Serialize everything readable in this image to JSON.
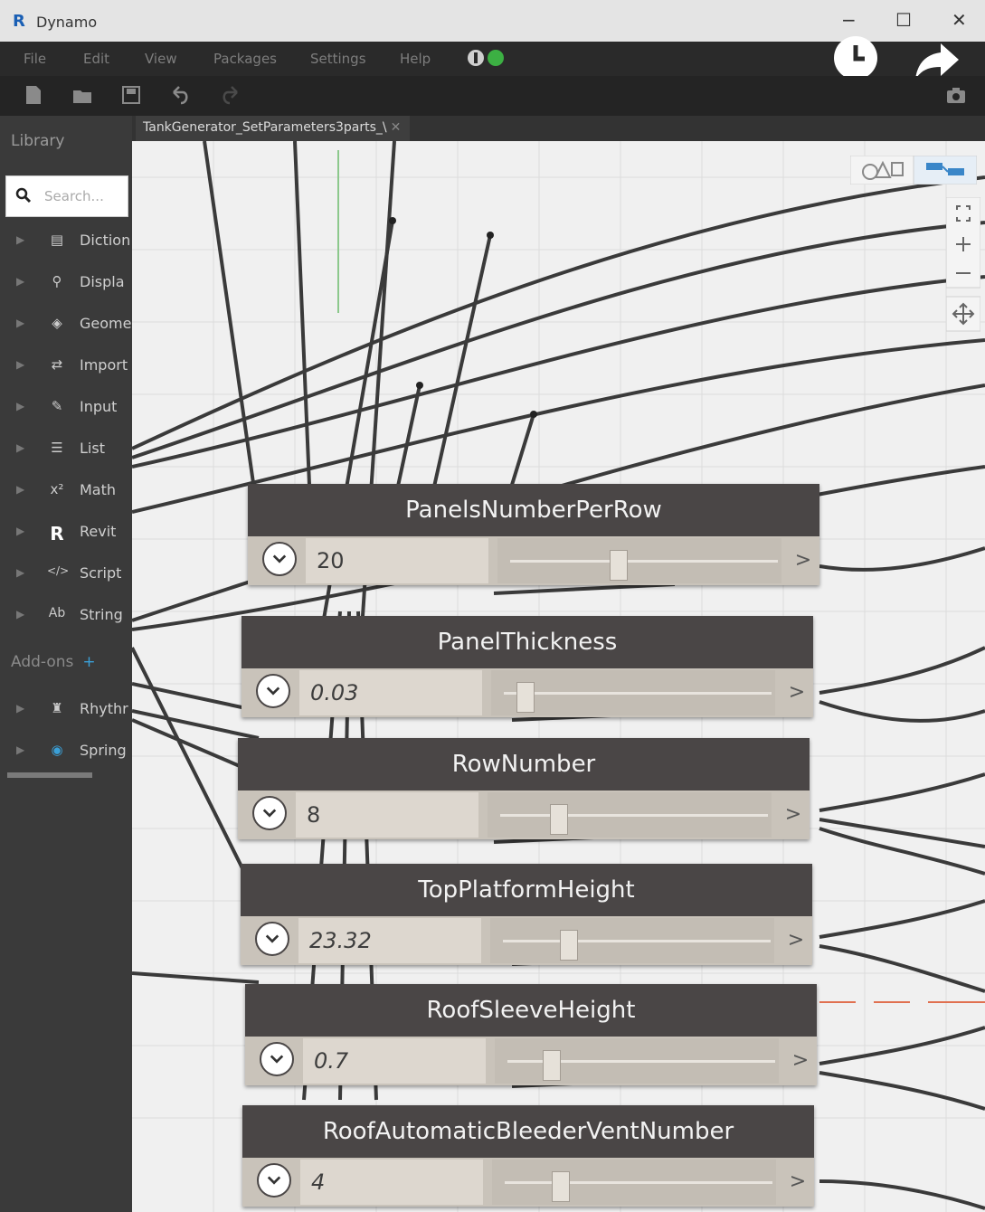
{
  "window": {
    "app_logo": "R",
    "title": "Dynamo",
    "minimize": "−",
    "maximize": "☐",
    "close": "✕"
  },
  "menu": {
    "items": [
      "File",
      "Edit",
      "View",
      "Packages",
      "Settings",
      "Help"
    ]
  },
  "library": {
    "header": "Library",
    "search_placeholder": "Search...",
    "items": [
      {
        "label": "Diction",
        "icon": "book-icon"
      },
      {
        "label": "Displa",
        "icon": "magnifier-icon"
      },
      {
        "label": "Geome",
        "icon": "cube-icon"
      },
      {
        "label": "Import",
        "icon": "arrows-icon"
      },
      {
        "label": "Input",
        "icon": "pencil-icon"
      },
      {
        "label": "List",
        "icon": "list-icon"
      },
      {
        "label": "Math",
        "icon": "math-icon"
      },
      {
        "label": "Revit",
        "icon": "revit-icon"
      },
      {
        "label": "Script",
        "icon": "code-icon"
      },
      {
        "label": "String",
        "icon": "string-icon"
      }
    ],
    "addons_label": "Add-ons",
    "addon_items": [
      {
        "label": "Rhythr",
        "icon": "rhythm-icon"
      },
      {
        "label": "Spring",
        "icon": "spring-icon"
      }
    ]
  },
  "tab": {
    "label": "TankGenerator_SetParameters3parts_\\",
    "close": "✕"
  },
  "nodes": [
    {
      "title": "PanelsNumberPerRow",
      "value": "20",
      "italic": false,
      "thumb": 0.4
    },
    {
      "title": "PanelThickness",
      "value": "0.03",
      "italic": true,
      "thumb": 0.05
    },
    {
      "title": "RowNumber",
      "value": "8",
      "italic": false,
      "thumb": 0.2
    },
    {
      "title": "TopPlatformHeight",
      "value": "23.32",
      "italic": true,
      "thumb": 0.23
    },
    {
      "title": "RoofSleeveHeight",
      "value": "0.7",
      "italic": true,
      "thumb": 0.14
    },
    {
      "title": "RoofAutomaticBleederVentNumber",
      "value": "4",
      "italic": true,
      "thumb": 0.19
    }
  ],
  "node_more": ">"
}
